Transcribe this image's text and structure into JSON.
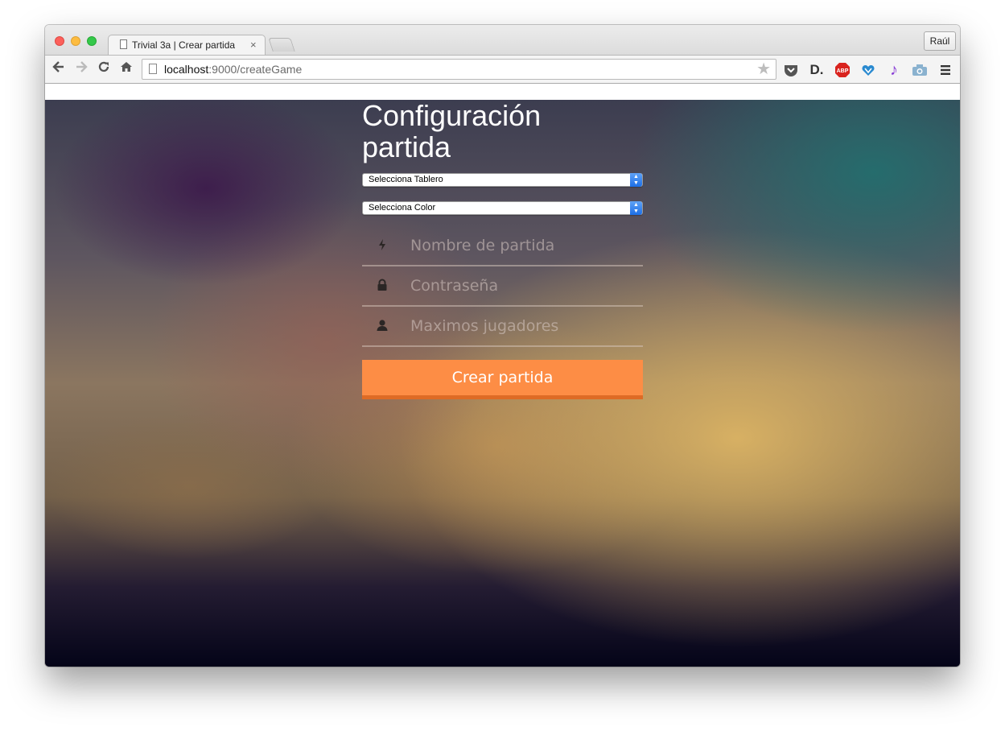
{
  "browser": {
    "tab_title": "Trivial 3a | Crear partida",
    "tab_close": "×",
    "profile_name": "Raúl",
    "url_host": "localhost",
    "url_path": ":9000/createGame"
  },
  "toolbar": {
    "back_icon": "arrow-left-icon",
    "forward_icon": "arrow-right-icon",
    "reload_icon": "reload-icon",
    "home_icon": "home-icon",
    "extensions": [
      "pocket-icon",
      "d-icon",
      "adblock-plus-icon",
      "heart-shield-icon",
      "music-note-icon",
      "camera-icon"
    ],
    "abp_label": "ABP",
    "d_label": "D."
  },
  "form": {
    "title": "Configuración partida",
    "board_select": "Selecciona Tablero",
    "color_select": "Selecciona Color",
    "game_name_placeholder": "Nombre de partida",
    "password_placeholder": "Contraseña",
    "max_players_placeholder": "Maximos jugadores",
    "submit_label": "Crear partida"
  },
  "colors": {
    "accent": "#fd8d45",
    "accent_border": "#de6b25",
    "select_arrow": "#2a7cea"
  }
}
